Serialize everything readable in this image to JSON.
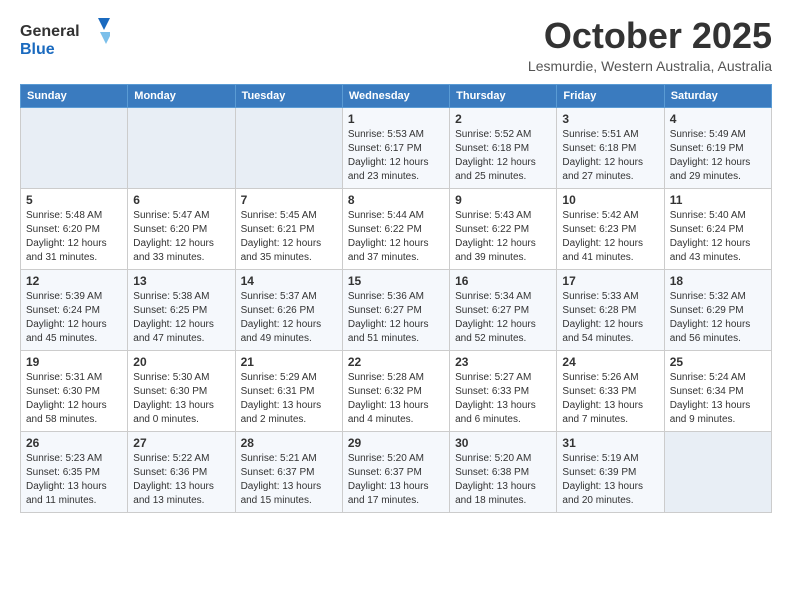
{
  "header": {
    "logo_general": "General",
    "logo_blue": "Blue",
    "title": "October 2025",
    "subtitle": "Lesmurdie, Western Australia, Australia"
  },
  "weekdays": [
    "Sunday",
    "Monday",
    "Tuesday",
    "Wednesday",
    "Thursday",
    "Friday",
    "Saturday"
  ],
  "weeks": [
    [
      {
        "day": "",
        "info": ""
      },
      {
        "day": "",
        "info": ""
      },
      {
        "day": "",
        "info": ""
      },
      {
        "day": "1",
        "info": "Sunrise: 5:53 AM\nSunset: 6:17 PM\nDaylight: 12 hours\nand 23 minutes."
      },
      {
        "day": "2",
        "info": "Sunrise: 5:52 AM\nSunset: 6:18 PM\nDaylight: 12 hours\nand 25 minutes."
      },
      {
        "day": "3",
        "info": "Sunrise: 5:51 AM\nSunset: 6:18 PM\nDaylight: 12 hours\nand 27 minutes."
      },
      {
        "day": "4",
        "info": "Sunrise: 5:49 AM\nSunset: 6:19 PM\nDaylight: 12 hours\nand 29 minutes."
      }
    ],
    [
      {
        "day": "5",
        "info": "Sunrise: 5:48 AM\nSunset: 6:20 PM\nDaylight: 12 hours\nand 31 minutes."
      },
      {
        "day": "6",
        "info": "Sunrise: 5:47 AM\nSunset: 6:20 PM\nDaylight: 12 hours\nand 33 minutes."
      },
      {
        "day": "7",
        "info": "Sunrise: 5:45 AM\nSunset: 6:21 PM\nDaylight: 12 hours\nand 35 minutes."
      },
      {
        "day": "8",
        "info": "Sunrise: 5:44 AM\nSunset: 6:22 PM\nDaylight: 12 hours\nand 37 minutes."
      },
      {
        "day": "9",
        "info": "Sunrise: 5:43 AM\nSunset: 6:22 PM\nDaylight: 12 hours\nand 39 minutes."
      },
      {
        "day": "10",
        "info": "Sunrise: 5:42 AM\nSunset: 6:23 PM\nDaylight: 12 hours\nand 41 minutes."
      },
      {
        "day": "11",
        "info": "Sunrise: 5:40 AM\nSunset: 6:24 PM\nDaylight: 12 hours\nand 43 minutes."
      }
    ],
    [
      {
        "day": "12",
        "info": "Sunrise: 5:39 AM\nSunset: 6:24 PM\nDaylight: 12 hours\nand 45 minutes."
      },
      {
        "day": "13",
        "info": "Sunrise: 5:38 AM\nSunset: 6:25 PM\nDaylight: 12 hours\nand 47 minutes."
      },
      {
        "day": "14",
        "info": "Sunrise: 5:37 AM\nSunset: 6:26 PM\nDaylight: 12 hours\nand 49 minutes."
      },
      {
        "day": "15",
        "info": "Sunrise: 5:36 AM\nSunset: 6:27 PM\nDaylight: 12 hours\nand 51 minutes."
      },
      {
        "day": "16",
        "info": "Sunrise: 5:34 AM\nSunset: 6:27 PM\nDaylight: 12 hours\nand 52 minutes."
      },
      {
        "day": "17",
        "info": "Sunrise: 5:33 AM\nSunset: 6:28 PM\nDaylight: 12 hours\nand 54 minutes."
      },
      {
        "day": "18",
        "info": "Sunrise: 5:32 AM\nSunset: 6:29 PM\nDaylight: 12 hours\nand 56 minutes."
      }
    ],
    [
      {
        "day": "19",
        "info": "Sunrise: 5:31 AM\nSunset: 6:30 PM\nDaylight: 12 hours\nand 58 minutes."
      },
      {
        "day": "20",
        "info": "Sunrise: 5:30 AM\nSunset: 6:30 PM\nDaylight: 13 hours\nand 0 minutes."
      },
      {
        "day": "21",
        "info": "Sunrise: 5:29 AM\nSunset: 6:31 PM\nDaylight: 13 hours\nand 2 minutes."
      },
      {
        "day": "22",
        "info": "Sunrise: 5:28 AM\nSunset: 6:32 PM\nDaylight: 13 hours\nand 4 minutes."
      },
      {
        "day": "23",
        "info": "Sunrise: 5:27 AM\nSunset: 6:33 PM\nDaylight: 13 hours\nand 6 minutes."
      },
      {
        "day": "24",
        "info": "Sunrise: 5:26 AM\nSunset: 6:33 PM\nDaylight: 13 hours\nand 7 minutes."
      },
      {
        "day": "25",
        "info": "Sunrise: 5:24 AM\nSunset: 6:34 PM\nDaylight: 13 hours\nand 9 minutes."
      }
    ],
    [
      {
        "day": "26",
        "info": "Sunrise: 5:23 AM\nSunset: 6:35 PM\nDaylight: 13 hours\nand 11 minutes."
      },
      {
        "day": "27",
        "info": "Sunrise: 5:22 AM\nSunset: 6:36 PM\nDaylight: 13 hours\nand 13 minutes."
      },
      {
        "day": "28",
        "info": "Sunrise: 5:21 AM\nSunset: 6:37 PM\nDaylight: 13 hours\nand 15 minutes."
      },
      {
        "day": "29",
        "info": "Sunrise: 5:20 AM\nSunset: 6:37 PM\nDaylight: 13 hours\nand 17 minutes."
      },
      {
        "day": "30",
        "info": "Sunrise: 5:20 AM\nSunset: 6:38 PM\nDaylight: 13 hours\nand 18 minutes."
      },
      {
        "day": "31",
        "info": "Sunrise: 5:19 AM\nSunset: 6:39 PM\nDaylight: 13 hours\nand 20 minutes."
      },
      {
        "day": "",
        "info": ""
      }
    ]
  ]
}
